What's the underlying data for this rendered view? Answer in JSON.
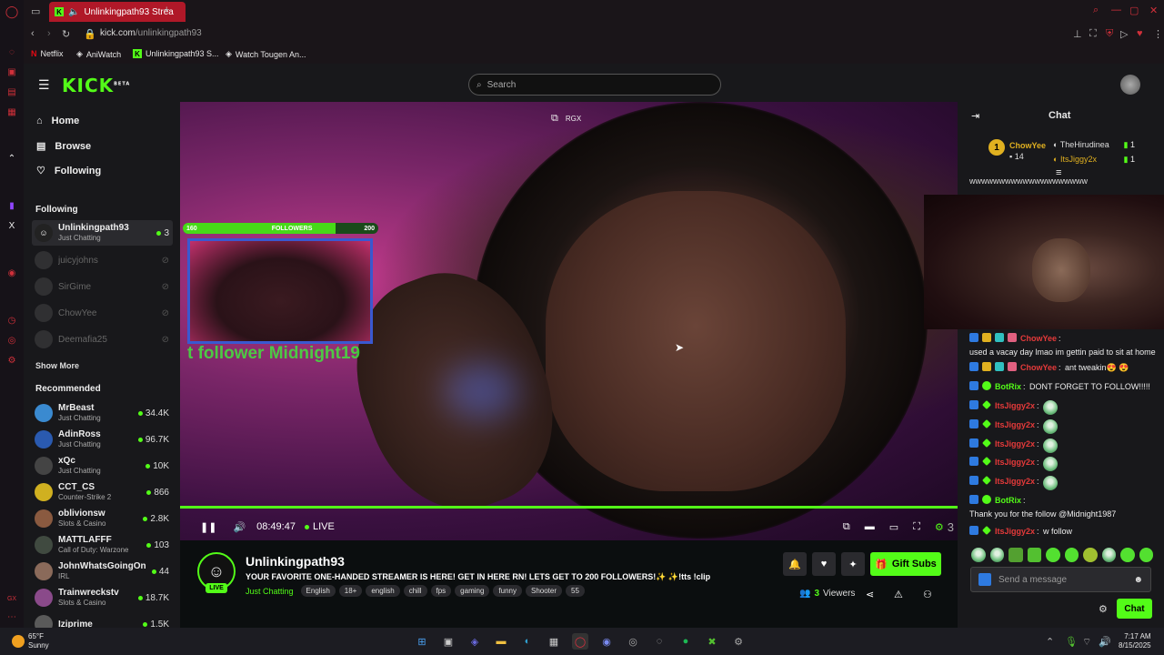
{
  "browser": {
    "tab_title": "Unlinkingpath93 Strea",
    "new_tab": "+",
    "url_host": "kick.com",
    "url_path": "/unlinkingpath93",
    "bookmarks": [
      "Netflix",
      "AniWatch",
      "Unlinkingpath93 S...",
      "Watch Tougen An..."
    ]
  },
  "header": {
    "logo": "KICK",
    "logo_sup": "BETA",
    "search_placeholder": "Search"
  },
  "sidebar": {
    "nav": [
      {
        "label": "Home",
        "icon": "home-icon"
      },
      {
        "label": "Browse",
        "icon": "browse-icon"
      },
      {
        "label": "Following",
        "icon": "heart-icon"
      }
    ],
    "following_title": "Following",
    "following": [
      {
        "name": "Unlinkingpath93",
        "category": "Just Chatting",
        "viewers": "3",
        "live": true
      },
      {
        "name": "juicyjohns",
        "live": false
      },
      {
        "name": "SirGime",
        "live": false
      },
      {
        "name": "ChowYee",
        "live": false
      },
      {
        "name": "Deemafia25",
        "live": false
      }
    ],
    "show_more": "Show More",
    "recommended_title": "Recommended",
    "recommended": [
      {
        "name": "MrBeast",
        "category": "Just Chatting",
        "viewers": "34.4K",
        "color": "#3a8ad0"
      },
      {
        "name": "AdinRoss",
        "category": "Just Chatting",
        "viewers": "96.7K",
        "color": "#2a5ab0"
      },
      {
        "name": "xQc",
        "category": "Just Chatting",
        "viewers": "10K",
        "color": "#444444"
      },
      {
        "name": "CCT_CS",
        "category": "Counter-Strike 2",
        "viewers": "866",
        "color": "#d0b020"
      },
      {
        "name": "oblivionsw",
        "category": "Slots & Casino",
        "viewers": "2.8K",
        "color": "#8a5a40"
      },
      {
        "name": "MATTLAFFF",
        "category": "Call of Duty: Warzone",
        "viewers": "103",
        "color": "#404a40"
      },
      {
        "name": "JohnWhatsGoingOn",
        "category": "IRL",
        "viewers": "44",
        "color": "#8a6a5a"
      },
      {
        "name": "Trainwreckstv",
        "category": "Slots & Casino",
        "viewers": "18.7K",
        "color": "#8a4a8a"
      },
      {
        "name": "Iziprime",
        "category": "",
        "viewers": "1.5K",
        "color": "#5a5a5a"
      }
    ]
  },
  "video": {
    "overlay_label": "RGX",
    "followers_goal_left": "160",
    "followers_goal_label": "FOLLOWERS",
    "followers_goal_right": "200",
    "followers_progress": 0.78,
    "alert_text": "t follower  Midnight19",
    "time": "08:49:47",
    "live": "LIVE",
    "corner_count": "3"
  },
  "stream": {
    "channel": "Unlinkingpath93",
    "title": "YOUR FAVORITE ONE-HANDED STREAMER IS HERE! GET IN HERE RN! LETS GET TO 200 FOLLOWERS!✨ ✨!tts !clip",
    "category": "Just Chatting",
    "tags": [
      "English",
      "18+",
      "english",
      "chill",
      "fps",
      "gaming",
      "funny",
      "Shooter",
      "55"
    ],
    "live_badge": "LIVE",
    "gift_subs": "Gift Subs",
    "viewers": "3",
    "viewers_label": "Viewers"
  },
  "chat": {
    "title": "Chat",
    "leader_top": {
      "name": "ChowYee",
      "count": "14",
      "rank": "1"
    },
    "leader_others": [
      {
        "name": "TheHirudinea",
        "count": "1"
      },
      {
        "name": "ItsJiggy2x",
        "count": "1"
      }
    ],
    "first_line": "wwwwwwwwwwwwwwwwwwww",
    "messages": [
      {
        "user": "ChowYee",
        "text": "used a vacay day lmao im gettin paid to sit at home",
        "color": "red"
      },
      {
        "user": "ChowYee",
        "text": "ant tweakin😍 😍",
        "color": "red"
      },
      {
        "user": "BotRix",
        "text": "DONT FORGET TO FOLLOW!!!!!",
        "color": "green"
      },
      {
        "user": "ItsJiggy2x",
        "text": "",
        "color": "red",
        "emote": true
      },
      {
        "user": "ItsJiggy2x",
        "text": "",
        "color": "red",
        "emote": true
      },
      {
        "user": "ItsJiggy2x",
        "text": "",
        "color": "red",
        "emote": true
      },
      {
        "user": "ItsJiggy2x",
        "text": "",
        "color": "red",
        "emote": true
      },
      {
        "user": "ItsJiggy2x",
        "text": "",
        "color": "red",
        "emote": true
      },
      {
        "user": "BotRix",
        "text": "Thank you for the follow @Midnight1987",
        "color": "green"
      },
      {
        "user": "ItsJiggy2x",
        "text": "w follow",
        "color": "red"
      }
    ],
    "input_placeholder": "Send a message",
    "send_label": "Chat"
  },
  "taskbar": {
    "weather_temp": "65°F",
    "weather_desc": "Sunny",
    "time": "7:17 AM",
    "date": "8/15/2025"
  },
  "colors": {
    "kick_green": "#53fc18",
    "opera_red": "#d0303a"
  }
}
